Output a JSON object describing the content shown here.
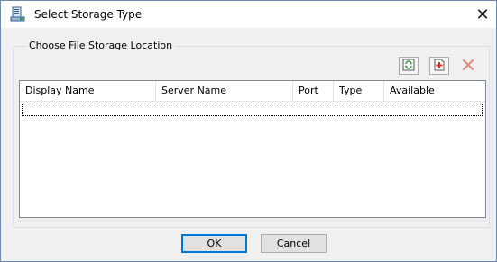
{
  "window": {
    "title": "Select Storage Type",
    "close_glyph": "✕",
    "icon": "storage-server-icon"
  },
  "group": {
    "legend": "Choose File Storage Location"
  },
  "toolbar": {
    "refresh_icon": "refresh-icon",
    "add_icon": "add-document-icon",
    "delete_icon": "delete-x-icon"
  },
  "list": {
    "columns": [
      "Display Name",
      "Server Name",
      "Port",
      "Type",
      "Available"
    ],
    "rows": []
  },
  "buttons": {
    "ok_mnemonic": "O",
    "ok_rest": "K",
    "cancel_mnemonic": "C",
    "cancel_rest": "ancel"
  },
  "colors": {
    "accent": "#0078d7",
    "delete_red": "#d9312b",
    "refresh_green": "#2f8f3a"
  }
}
